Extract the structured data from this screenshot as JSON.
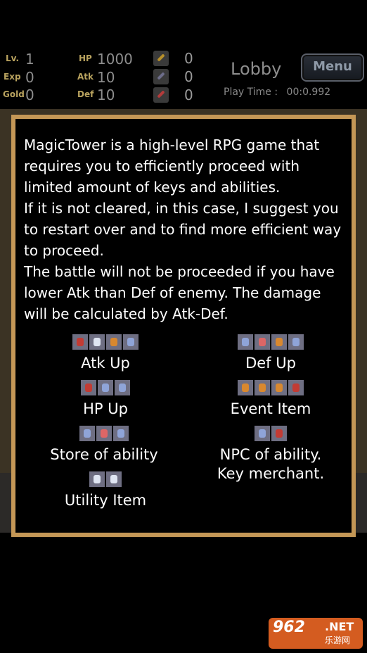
{
  "hud": {
    "level_label": "Lv.",
    "level_value": "1",
    "exp_label": "Exp",
    "exp_value": "0",
    "gold_label": "Gold",
    "gold_value": "0",
    "hp_label": "HP",
    "hp_value": "1000",
    "atk_label": "Atk",
    "atk_value": "10",
    "def_label": "Def",
    "def_value": "10",
    "keys": [
      {
        "name": "yellow-key-icon",
        "count": "0"
      },
      {
        "name": "blue-key-icon",
        "count": "0"
      },
      {
        "name": "red-key-icon",
        "count": "0"
      }
    ],
    "location": "Lobby",
    "menu_label": "Menu",
    "play_time_label": "Play Time :",
    "play_time_value": "00:0.992"
  },
  "dialog": {
    "paragraphs": [
      "MagicTower is a high-level RPG game that requires you to efficiently proceed with limited amount of keys and abilities.",
      "If it is not cleared, in this case, I suggest you to restart over and to find more efficient way to proceed.",
      "The battle will not be proceeded if you have lower Atk than Def of enemy. The damage will be calculated by Atk-Def."
    ],
    "items": {
      "atk_up": "Atk Up",
      "def_up": "Def Up",
      "hp_up": "HP Up",
      "event_item": "Event Item",
      "store": "Store of ability",
      "npc": "NPC of ability.",
      "key_merchant": "Key merchant.",
      "utility": "Utility Item"
    }
  },
  "watermark": {
    "number": "962",
    "net": ".NET",
    "sub": "乐游网"
  }
}
